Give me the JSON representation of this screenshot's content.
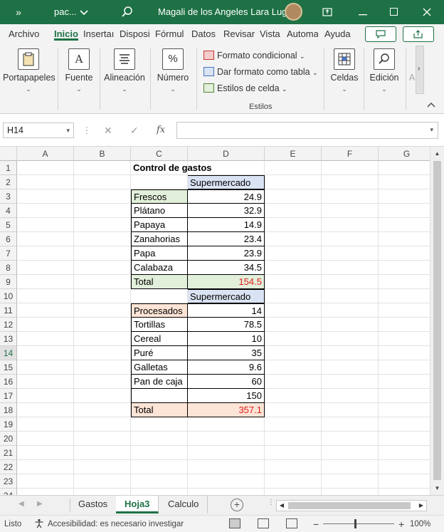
{
  "titlebar": {
    "more": "»",
    "file": "pac...",
    "user": "Magali de los Angeles Lara Lugo",
    "icons": [
      "search-icon",
      "restore-icon",
      "minimize-icon",
      "maximize-icon",
      "close-icon"
    ]
  },
  "ribbon_tabs": [
    "Archivo",
    "Inicio",
    "Insertar",
    "Disposición",
    "Fórmulas",
    "Datos",
    "Revisar",
    "Vista",
    "Automatizar",
    "Ayuda"
  ],
  "ribbon_tab_display": [
    "Archivo",
    "Inicio",
    "Insertaı",
    "Disposi",
    "Fórmul",
    "Datos",
    "Revisar",
    "Vista",
    "Automa",
    "Ayuda"
  ],
  "ribbon": {
    "groups": {
      "clipboard": "Portapapeles",
      "font": "Fuente",
      "align": "Alineación",
      "number": "Número",
      "cells": "Celdas",
      "editing": "Edición"
    },
    "styles": {
      "conditional": "Formato condicional",
      "as_table": "Dar formato como tabla",
      "cell_styles": "Estilos de celda",
      "group_label": "Estilos"
    },
    "overflow_label": "A"
  },
  "formula_bar": {
    "name_box": "H14",
    "fx": "fx",
    "formula": ""
  },
  "columns": [
    "A",
    "B",
    "C",
    "D",
    "E",
    "F",
    "G"
  ],
  "rows": [
    "1",
    "2",
    "3",
    "4",
    "5",
    "6",
    "7",
    "8",
    "9",
    "10",
    "11",
    "12",
    "13",
    "14",
    "15",
    "16",
    "17",
    "18",
    "19",
    "20",
    "21",
    "22",
    "23",
    "24"
  ],
  "cells": {
    "C1": "Control de gastos",
    "D2": "Supermercado",
    "C3": "Frescos",
    "D3": "24.9",
    "C4": "Plátano",
    "D4": "32.9",
    "C5": "Papaya",
    "D5": "14.9",
    "C6": "Zanahorias",
    "D6": "23.4",
    "C7": "Papa",
    "D7": "23.9",
    "C8": "Calabaza",
    "D8": "34.5",
    "C9": "Total",
    "D9": "154.5",
    "D10": "Supermercado",
    "C11": "Procesados",
    "D11": "14",
    "C12": "Tortillas",
    "D12": "78.5",
    "C13": "Cereal",
    "D13": "10",
    "C14": "Puré",
    "D14": "35",
    "C15": "Galletas",
    "D15": "9.6",
    "C16": "Pan de caja",
    "D16": "60",
    "D17": "150",
    "C18": "Total",
    "D18": "357.1"
  },
  "fill_colors": {
    "blue": "#dae3f3",
    "green": "#e2efda",
    "orange": "#fce4d6",
    "total_text": "#e0201e",
    "excel_green": "#1e7145"
  },
  "sheets": [
    {
      "label": "Gastos",
      "active": false
    },
    {
      "label": "Hoja3",
      "active": true
    },
    {
      "label": "Calculo",
      "active": false
    }
  ],
  "status": {
    "ready": "Listo",
    "accessibility": "Accesibilidad: es necesario investigar",
    "zoom": "100%",
    "zoom_minus": "−",
    "zoom_plus": "+"
  }
}
